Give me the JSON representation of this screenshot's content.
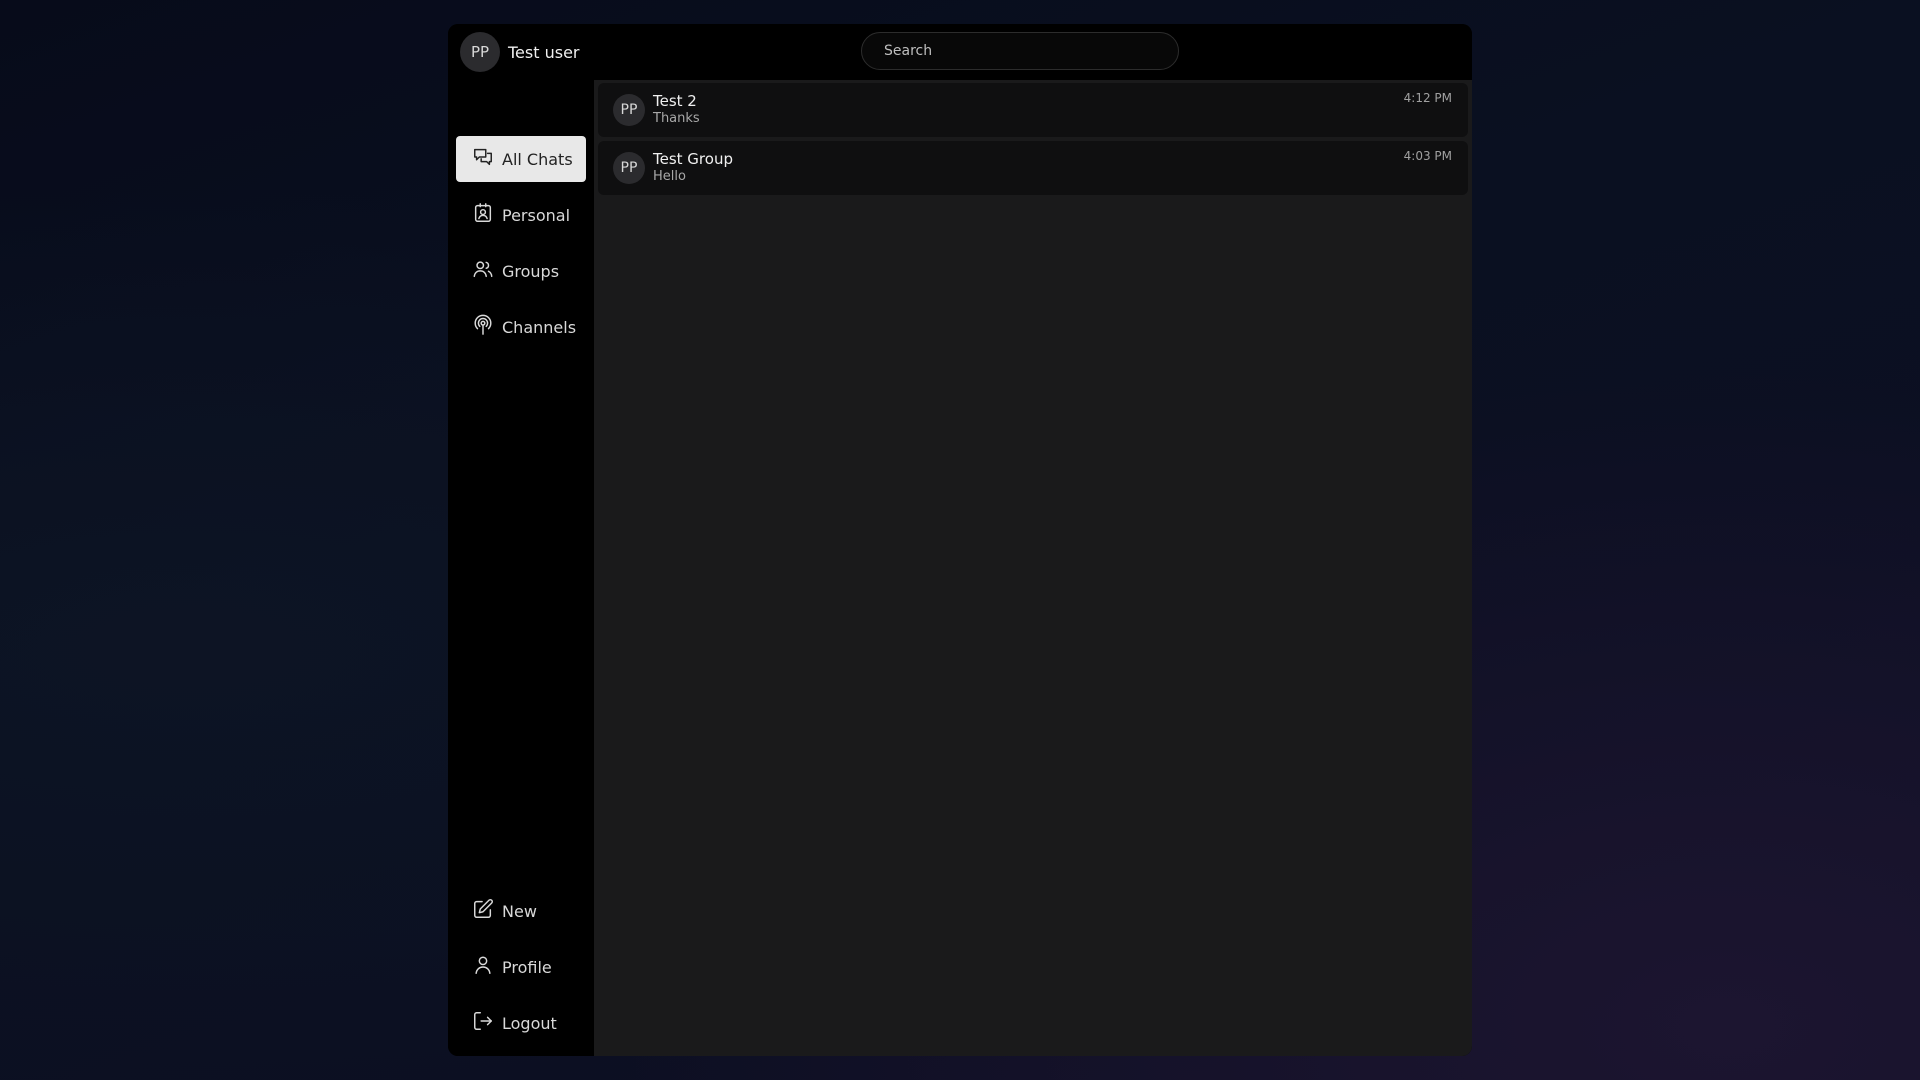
{
  "header": {
    "user": {
      "initials": "PP",
      "name": "Test user"
    },
    "search": {
      "placeholder": "Search",
      "value": ""
    }
  },
  "sidebar": {
    "top_items": [
      {
        "label": "All Chats",
        "icon": "chat-bubbles-icon",
        "active": true
      },
      {
        "label": "Personal",
        "icon": "contact-card-icon"
      },
      {
        "label": "Groups",
        "icon": "users-icon"
      },
      {
        "label": "Channels",
        "icon": "broadcast-icon"
      }
    ],
    "bottom_items": [
      {
        "label": "New",
        "icon": "edit-icon"
      },
      {
        "label": "Profile",
        "icon": "user-icon"
      },
      {
        "label": "Logout",
        "icon": "logout-icon"
      }
    ]
  },
  "chats": [
    {
      "initials": "PP",
      "name": "Test 2",
      "preview": "Thanks",
      "time": "4:12 PM"
    },
    {
      "initials": "PP",
      "name": "Test Group",
      "preview": "Hello",
      "time": "4:03 PM"
    }
  ],
  "colors": {
    "active_nav_bg": "#e8e8e8",
    "panel_bg": "#1a1a1b",
    "chat_item_bg": "#0f0f10",
    "sidebar_bg": "#000000"
  }
}
